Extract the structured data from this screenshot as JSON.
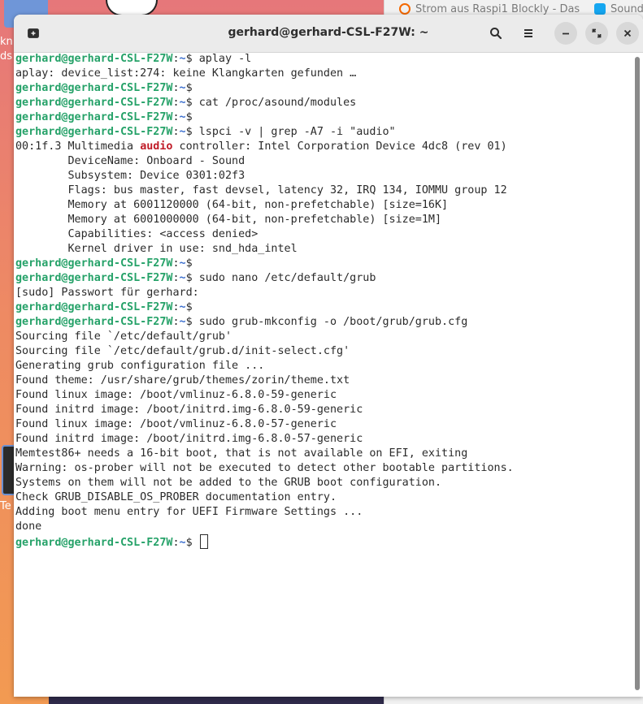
{
  "desktop": {
    "label_1": "kn",
    "label_2": "ds",
    "label_3": "Te"
  },
  "background_browser": {
    "tabs": [
      {
        "label": "Strom aus Raspi1 Blockly - Das",
        "icon": "grafana-icon",
        "color": "#f46800"
      },
      {
        "label": "Sound",
        "icon": "zorin-icon",
        "color": "#15a6f0"
      }
    ]
  },
  "terminal": {
    "title": "gerhard@gerhard-CSL-F27W: ~",
    "prompt": {
      "user_host": "gerhard@gerhard-CSL-F27W",
      "colon": ":",
      "path": "~",
      "symbol": "$ "
    },
    "lines": [
      {
        "type": "cmd",
        "text": "aplay -l"
      },
      {
        "type": "out",
        "text": "aplay: device_list:274: keine Klangkarten gefunden …"
      },
      {
        "type": "cmd",
        "text": ""
      },
      {
        "type": "cmd",
        "text": "cat /proc/asound/modules"
      },
      {
        "type": "cmd",
        "text": ""
      },
      {
        "type": "cmd",
        "text": "lspci -v | grep -A7 -i \"audio\""
      },
      {
        "type": "hl",
        "pre": "00:1f.3 Multimedia ",
        "hl": "audio",
        "post": " controller: Intel Corporation Device 4dc8 (rev 01)"
      },
      {
        "type": "out",
        "text": "        DeviceName: Onboard - Sound"
      },
      {
        "type": "out",
        "text": "        Subsystem: Device 0301:02f3"
      },
      {
        "type": "out",
        "text": "        Flags: bus master, fast devsel, latency 32, IRQ 134, IOMMU group 12"
      },
      {
        "type": "out",
        "text": "        Memory at 6001120000 (64-bit, non-prefetchable) [size=16K]"
      },
      {
        "type": "out",
        "text": "        Memory at 6001000000 (64-bit, non-prefetchable) [size=1M]"
      },
      {
        "type": "out",
        "text": "        Capabilities: <access denied>"
      },
      {
        "type": "out",
        "text": "        Kernel driver in use: snd_hda_intel"
      },
      {
        "type": "cmd",
        "text": ""
      },
      {
        "type": "cmd",
        "text": "sudo nano /etc/default/grub"
      },
      {
        "type": "out",
        "text": "[sudo] Passwort für gerhard:"
      },
      {
        "type": "cmd",
        "text": ""
      },
      {
        "type": "cmd",
        "text": "sudo grub-mkconfig -o /boot/grub/grub.cfg"
      },
      {
        "type": "out",
        "text": "Sourcing file `/etc/default/grub'"
      },
      {
        "type": "out",
        "text": "Sourcing file `/etc/default/grub.d/init-select.cfg'"
      },
      {
        "type": "out",
        "text": "Generating grub configuration file ..."
      },
      {
        "type": "out",
        "text": "Found theme: /usr/share/grub/themes/zorin/theme.txt"
      },
      {
        "type": "out",
        "text": "Found linux image: /boot/vmlinuz-6.8.0-59-generic"
      },
      {
        "type": "out",
        "text": "Found initrd image: /boot/initrd.img-6.8.0-59-generic"
      },
      {
        "type": "out",
        "text": "Found linux image: /boot/vmlinuz-6.8.0-57-generic"
      },
      {
        "type": "out",
        "text": "Found initrd image: /boot/initrd.img-6.8.0-57-generic"
      },
      {
        "type": "out",
        "text": "Memtest86+ needs a 16-bit boot, that is not available on EFI, exiting"
      },
      {
        "type": "out",
        "text": "Warning: os-prober will not be executed to detect other bootable partitions."
      },
      {
        "type": "out",
        "text": "Systems on them will not be added to the GRUB boot configuration."
      },
      {
        "type": "out",
        "text": "Check GRUB_DISABLE_OS_PROBER documentation entry."
      },
      {
        "type": "out",
        "text": "Adding boot menu entry for UEFI Firmware Settings ..."
      },
      {
        "type": "out",
        "text": "done"
      },
      {
        "type": "cursor",
        "text": ""
      }
    ],
    "colors": {
      "prompt_user": "#26a269",
      "prompt_path": "#3b6fcf",
      "highlight": "#c01c28",
      "background": "#ffffff",
      "headerbar": "#ebebeb"
    }
  }
}
